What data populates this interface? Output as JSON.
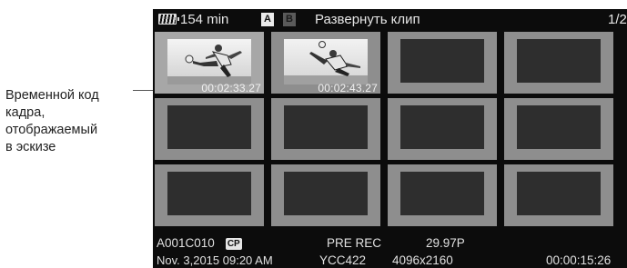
{
  "annotation": {
    "lines": [
      "Временной код",
      "кадра,",
      "отображаемый",
      "в эскизе"
    ]
  },
  "status_bar": {
    "battery_icon": "battery-icon",
    "remaining_time": "154 min",
    "slot_a": "A",
    "slot_b": "B",
    "title": "Развернуть клип",
    "page": "1/2"
  },
  "thumbnails": [
    {
      "timecode": "00:02:33.27",
      "has_image": true,
      "selected": true
    },
    {
      "timecode": "00:02:43.27",
      "has_image": true,
      "selected": false
    },
    {
      "timecode": "",
      "has_image": false,
      "selected": false
    },
    {
      "timecode": "",
      "has_image": false,
      "selected": false
    },
    {
      "timecode": "",
      "has_image": false,
      "selected": false
    },
    {
      "timecode": "",
      "has_image": false,
      "selected": false
    },
    {
      "timecode": "",
      "has_image": false,
      "selected": false
    },
    {
      "timecode": "",
      "has_image": false,
      "selected": false
    },
    {
      "timecode": "",
      "has_image": false,
      "selected": false
    },
    {
      "timecode": "",
      "has_image": false,
      "selected": false
    },
    {
      "timecode": "",
      "has_image": false,
      "selected": false
    },
    {
      "timecode": "",
      "has_image": false,
      "selected": false
    }
  ],
  "clip_info": {
    "clip_name": "A001C010",
    "cp_badge": "CP",
    "date": "Nov. 3,2015 09:20 AM",
    "rec_mode": "PRE REC",
    "color": "YCC422",
    "frame_rate": "29.97P",
    "resolution": "4096x2160",
    "duration": "00:00:15:26"
  }
}
